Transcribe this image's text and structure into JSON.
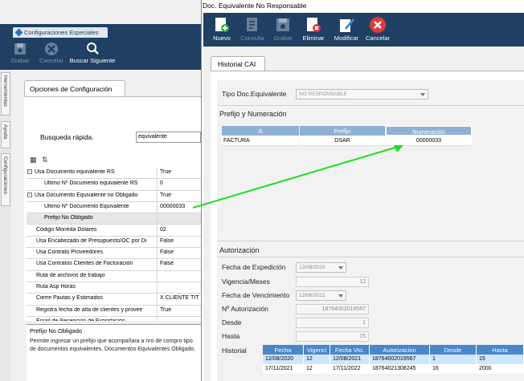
{
  "left": {
    "doc_tab": "Configuraciones Especiales",
    "toolbar": [
      {
        "label": "Grabar",
        "icon": "save-icon",
        "enabled": false
      },
      {
        "label": "Cancelar",
        "icon": "cancel-icon",
        "enabled": false
      },
      {
        "label": "Buscar Siguiente",
        "icon": "search-icon",
        "enabled": true
      }
    ],
    "side_tabs": [
      "Herramientas",
      "Ayuda",
      "Configuraciones"
    ],
    "panel_tab": "Opciones de Configuración",
    "quick_search": {
      "label": "Busqueda rápida.",
      "value": "equivalente"
    },
    "grid": [
      {
        "name": "Usa Documento equivalente RS",
        "value": "True",
        "level": 0,
        "expander": "-"
      },
      {
        "name": "Ultimo Nº Documento equivalente RS",
        "value": "0",
        "level": 1
      },
      {
        "name": "Usa Documento Equivalente no Obligado",
        "value": "True",
        "level": 0,
        "expander": "-"
      },
      {
        "name": "Ultimo Nº Documento Equivalente",
        "value": "00000033",
        "level": 1
      },
      {
        "name": "Prefijo No Obligado",
        "value": "",
        "level": 1,
        "selected": true
      },
      {
        "name": "Código Moneda Dólares",
        "value": "02",
        "level": 0
      },
      {
        "name": "Usa Encabezado de Presupuesto/OC por Di",
        "value": "False",
        "level": 0
      },
      {
        "name": "Usa Contrato Proveedores",
        "value": "False",
        "level": 0
      },
      {
        "name": "Usa Contratos Clientes de Facturación",
        "value": "False",
        "level": 0
      },
      {
        "name": "Ruta de archivos de trabajo",
        "value": "",
        "level": 0
      },
      {
        "name": "Ruta Asp Horas",
        "value": "",
        "level": 0
      },
      {
        "name": "Cierre Pautas y Estimados",
        "value": "X CLIENTE TIT",
        "level": 0
      },
      {
        "name": "Registra fecha de alta de clientes y provee",
        "value": "True",
        "level": 0
      },
      {
        "name": "Email de Recepción de Exportación",
        "value": "",
        "level": 0
      }
    ],
    "description": {
      "title": "Prefijo No Obligado",
      "text": "Permite ingresar un prefijo que acompañara a nro de compro tipo de documentos equivalentes, Documentos Equivalentes Obligado."
    }
  },
  "right": {
    "title": "Doc. Equivalente No Responsable",
    "toolbar": [
      {
        "label": "Nuevo",
        "icon": "new-document-icon",
        "enabled": true
      },
      {
        "label": "Consulta",
        "icon": "query-icon",
        "enabled": false
      },
      {
        "label": "Grabar",
        "icon": "save-icon",
        "enabled": false
      },
      {
        "label": "Eliminar",
        "icon": "delete-icon",
        "enabled": true
      },
      {
        "label": "Modificar",
        "icon": "edit-icon",
        "enabled": true
      },
      {
        "label": "Cancelar",
        "icon": "cancel-icon",
        "enabled": true
      }
    ],
    "tab": "Historial CAI",
    "tipo_doc": {
      "label": "Tipo Doc.Equivalente",
      "value": "NO RESPONSABLE"
    },
    "prefijo_section": "Prefijo y Numeración",
    "prefijo_table": {
      "headers": [
        "A",
        "Prefijo",
        "Numeración"
      ],
      "rows": [
        [
          "FACTURA",
          "DSAR",
          "00000033"
        ]
      ]
    },
    "autorizacion_section": "Autorización",
    "fields": {
      "fecha_expedicion": {
        "label": "Fecha de Expedición",
        "value": "12/08/2020"
      },
      "vigencia": {
        "label": "Vigencia/Meses",
        "value": "12"
      },
      "fecha_vencimiento": {
        "label": "Fecha de Vencimiento",
        "value": "12/08/2021"
      },
      "autorizacion": {
        "label": "Nº Autorización",
        "value": "18764002019567"
      },
      "desde": {
        "label": "Desde",
        "value": "1"
      },
      "hasta": {
        "label": "Hasta",
        "value": "15"
      }
    },
    "historial": {
      "label": "Historial",
      "headers": [
        "Fecha",
        "Vigenci",
        "Fecha Vto.",
        "Autorizacion",
        "Desde",
        "Hasta"
      ],
      "rows": [
        [
          "12/08/2020",
          "12",
          "12/08/2021",
          "18764002019567",
          "1",
          "15"
        ],
        [
          "17/11/2021",
          "12",
          "17/11/2022",
          "18764021308245",
          "16",
          "2000"
        ]
      ]
    }
  },
  "colors": {
    "toolbar_bg": "#1f3f63",
    "arrow": "#22dd22",
    "header_blue": "#4a86c8"
  }
}
